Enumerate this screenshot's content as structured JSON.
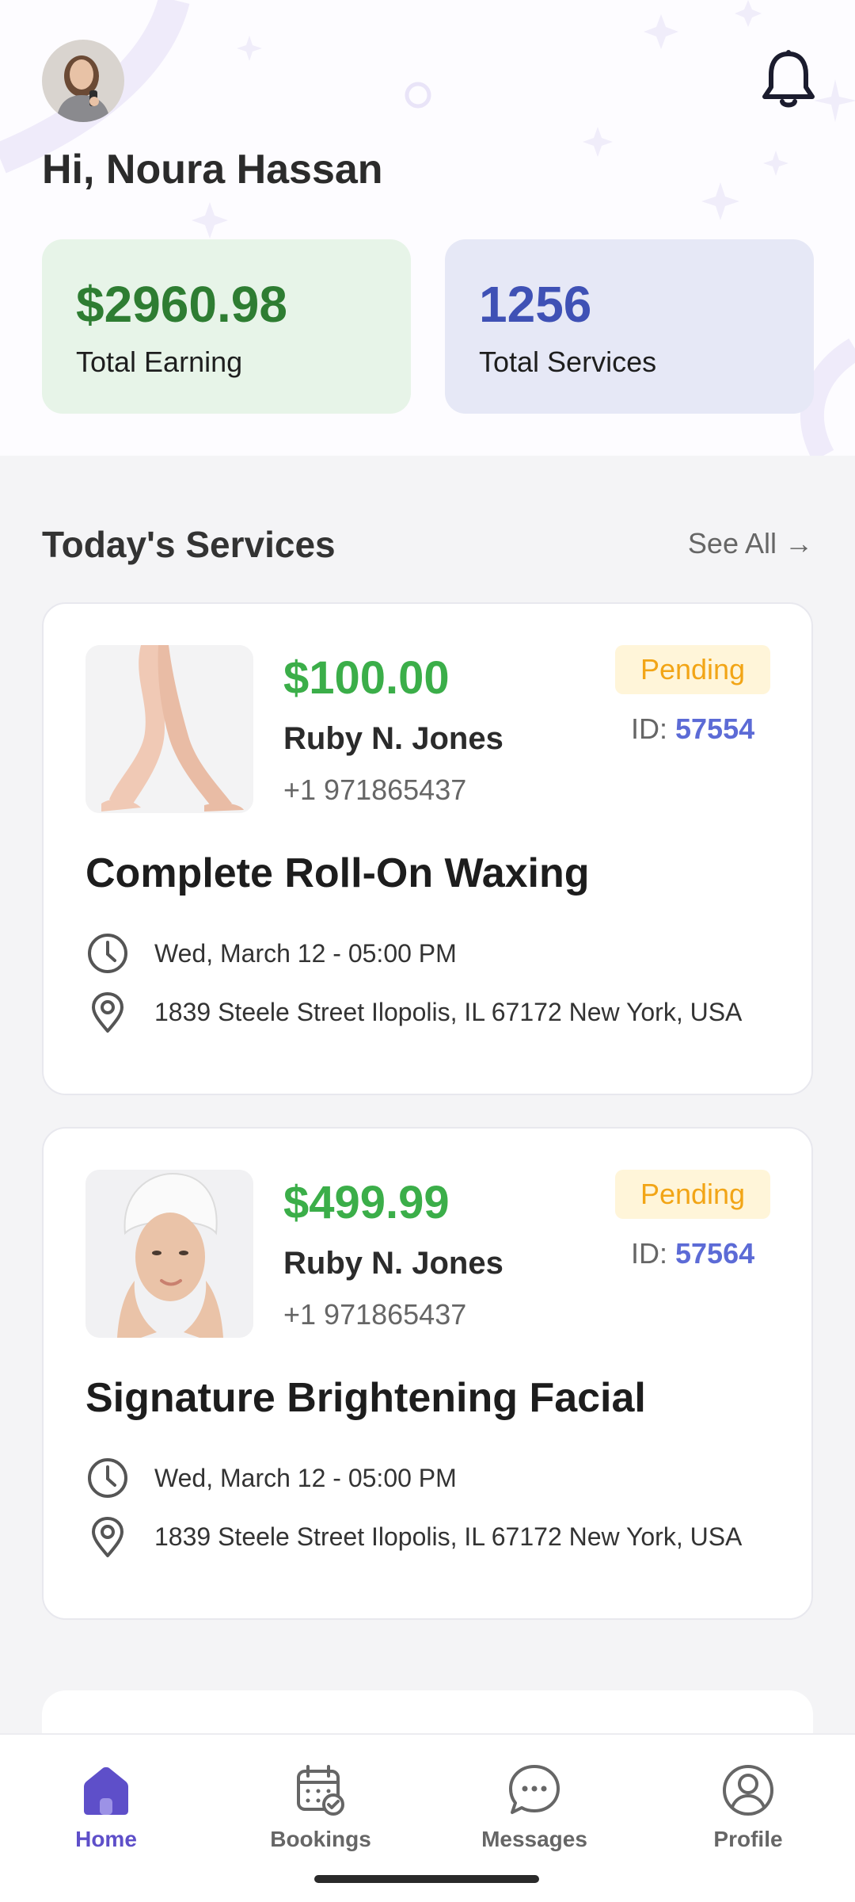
{
  "header": {
    "greeting": "Hi, Noura Hassan",
    "avatar_icon": "user-avatar",
    "notification_icon": "bell-icon"
  },
  "stats": {
    "earning": {
      "value": "$2960.98",
      "label": "Total Earning",
      "color": "#2e7d32"
    },
    "services": {
      "value": "1256",
      "label": "Total Services",
      "color": "#3f51b5"
    }
  },
  "section": {
    "title": "Today's Services",
    "see_all": "See All →"
  },
  "services": [
    {
      "price": "$100.00",
      "customer": "Ruby N. Jones",
      "phone": "+1 971865437",
      "status": "Pending",
      "id_label": "ID: ",
      "id": "57554",
      "title": "Complete Roll-On Waxing",
      "datetime": "Wed, March 12 - 05:00 PM",
      "address": "1839 Steele Street Ilopolis, IL 67172 New York, USA",
      "image": "legs-waxing-photo"
    },
    {
      "price": "$499.99",
      "customer": "Ruby N. Jones",
      "phone": "+1 971865437",
      "status": "Pending",
      "id_label": "ID: ",
      "id": "57564",
      "title": "Signature Brightening Facial",
      "datetime": "Wed, March 12 - 05:00 PM",
      "address": "1839 Steele Street Ilopolis, IL 67172 New York, USA",
      "image": "facial-woman-photo"
    }
  ],
  "nav": {
    "items": [
      {
        "label": "Home",
        "icon": "home-icon",
        "active": true
      },
      {
        "label": "Bookings",
        "icon": "calendar-check-icon",
        "active": false
      },
      {
        "label": "Messages",
        "icon": "chat-bubble-icon",
        "active": false
      },
      {
        "label": "Profile",
        "icon": "user-circle-icon",
        "active": false
      }
    ]
  },
  "colors": {
    "accent": "#5e4fc9",
    "price_green": "#3bae49",
    "pending": "#f2a516",
    "id_blue": "#5c6bd6"
  }
}
